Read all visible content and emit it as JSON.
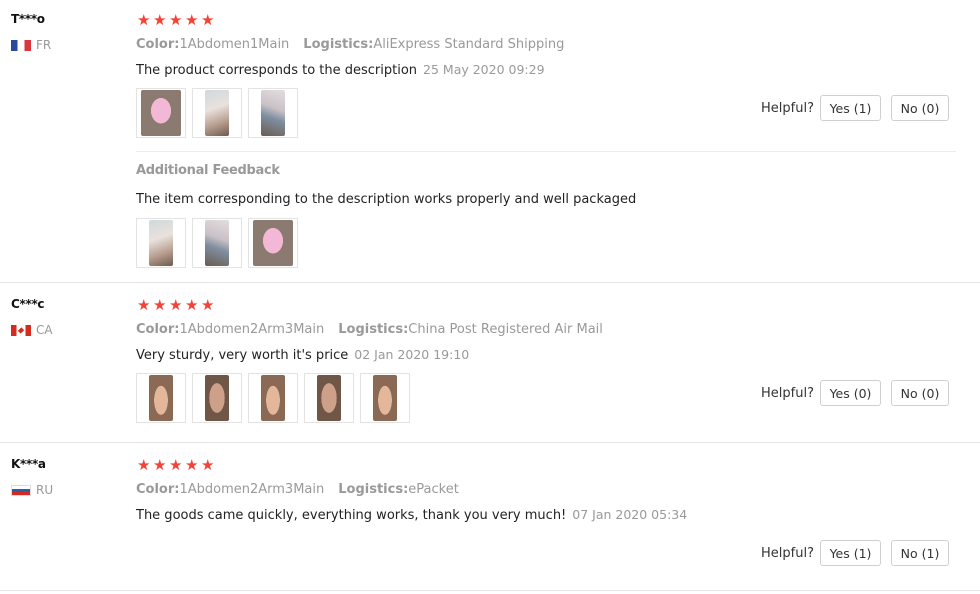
{
  "helpful_label": "Helpful?",
  "star_glyph": "★",
  "star_color": "#f44336",
  "reviews": [
    {
      "buyer": "T***o",
      "country": "FR",
      "flag": "flag-fr",
      "rating": 5,
      "color_label": "Color:",
      "color_value": "1Abdomen1Main",
      "logistics_label": "Logistics:",
      "logistics_value": "AliExpress Standard Shipping",
      "text": "The product corresponds to the description",
      "date": "25 May 2020 09:29",
      "yes": "Yes (1)",
      "no": "No (0)",
      "additional_label": "Additional Feedback",
      "additional_text": "The item corresponding to the description works properly and well packaged"
    },
    {
      "buyer": "C***c",
      "country": "CA",
      "flag": "flag-ca",
      "rating": 5,
      "color_label": "Color:",
      "color_value": "1Abdomen2Arm3Main",
      "logistics_label": "Logistics:",
      "logistics_value": "China Post Registered Air Mail",
      "text": "Very sturdy, very worth it's price",
      "date": "02 Jan 2020 19:10",
      "yes": "Yes (0)",
      "no": "No (0)"
    },
    {
      "buyer": "K***a",
      "country": "RU",
      "flag": "flag-ru",
      "rating": 5,
      "color_label": "Color:",
      "color_value": "1Abdomen2Arm3Main",
      "logistics_label": "Logistics:",
      "logistics_value": "ePacket",
      "text": "The goods came quickly, everything works, thank you very much!",
      "date": "07 Jan 2020 05:34",
      "yes": "Yes (1)",
      "no": "No (1)"
    }
  ]
}
